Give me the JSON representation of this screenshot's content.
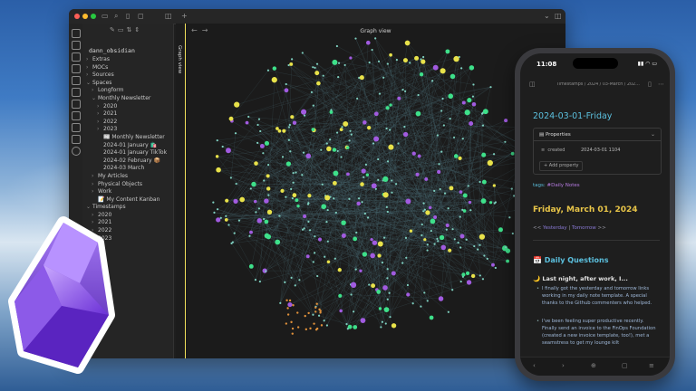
{
  "desktop": {
    "window": {
      "traffic_lights": [
        "#ff5f57",
        "#febc2e",
        "#28c840"
      ]
    },
    "sidebar": {
      "vault_name": "dann_obsidian",
      "tree": [
        {
          "label": "Extras",
          "caret": "›",
          "indent": 0
        },
        {
          "label": "MOCs",
          "caret": "›",
          "indent": 0
        },
        {
          "label": "Sources",
          "caret": "›",
          "indent": 0
        },
        {
          "label": "Spaces",
          "caret": "⌄",
          "indent": 0
        },
        {
          "label": "Longform",
          "caret": "›",
          "indent": 1
        },
        {
          "label": "Monthly Newsletter",
          "caret": "⌄",
          "indent": 1
        },
        {
          "label": "2020",
          "caret": "›",
          "indent": 2
        },
        {
          "label": "2021",
          "caret": "›",
          "indent": 2
        },
        {
          "label": "2022",
          "caret": "›",
          "indent": 2
        },
        {
          "label": "2023",
          "caret": "›",
          "indent": 2
        },
        {
          "label": "📰 Monthly Newsletter",
          "caret": "",
          "indent": 2
        },
        {
          "label": "2024-01 January 🛍️",
          "caret": "",
          "indent": 2
        },
        {
          "label": "2024-01 January TikTok",
          "caret": "",
          "indent": 2
        },
        {
          "label": "2024-02 February 📦",
          "caret": "",
          "indent": 2
        },
        {
          "label": "2024-03 March",
          "caret": "",
          "indent": 2
        },
        {
          "label": "My Articles",
          "caret": "›",
          "indent": 1
        },
        {
          "label": "Physical Objects",
          "caret": "›",
          "indent": 1
        },
        {
          "label": "Work",
          "caret": "›",
          "indent": 1
        },
        {
          "label": "📝 My Content Kanban",
          "caret": "",
          "indent": 1
        },
        {
          "label": "Timestamps",
          "caret": "⌄",
          "indent": 0
        },
        {
          "label": "2020",
          "caret": "›",
          "indent": 1
        },
        {
          "label": "2021",
          "caret": "›",
          "indent": 1
        },
        {
          "label": "2022",
          "caret": "›",
          "indent": 1
        },
        {
          "label": "2023",
          "caret": "›",
          "indent": 1
        }
      ]
    },
    "side_tab_label": "Graph view",
    "graph_pane": {
      "title": "Graph view",
      "colors": {
        "base": "#7fd0c0",
        "green": "#3ee08a",
        "purple": "#a15be0",
        "yellow": "#e8e24a",
        "orange": "#e0903a",
        "edge": "#4a6a75"
      }
    }
  },
  "phone": {
    "status": {
      "time": "11:08",
      "icons": "▮▮ ◠ ▭"
    },
    "breadcrumb": "Timestamps / 2024 / 03-March / 202…",
    "note_title": "2024-03-01-Friday",
    "properties": {
      "header": "Properties",
      "rows": [
        {
          "key": "created",
          "value": "2024-03-01 1104"
        }
      ],
      "add_label": "+ Add property"
    },
    "tags": {
      "label": "tags:",
      "value": "#Daily Notes"
    },
    "date_heading": "Friday, March 01, 2024",
    "nav": {
      "prefix": "<<",
      "yesterday": "Yesterday",
      "sep": "|",
      "tomorrow": "Tomorrow",
      "suffix": ">>"
    },
    "section_icon": "📅",
    "section_title": "Daily Questions",
    "question_icon": "🌙",
    "question": "Last night, after work, I...",
    "bullets": [
      "I finally got the yesterday and tomorrow links working in my daily note template. A special thanks to the Github commenters who helped.",
      "I've been feeling super productive recently. Finally send an invoice to the FinOps Foundation (created a new invoice template, too!), met a seamstress to get my lounge kilt"
    ]
  }
}
